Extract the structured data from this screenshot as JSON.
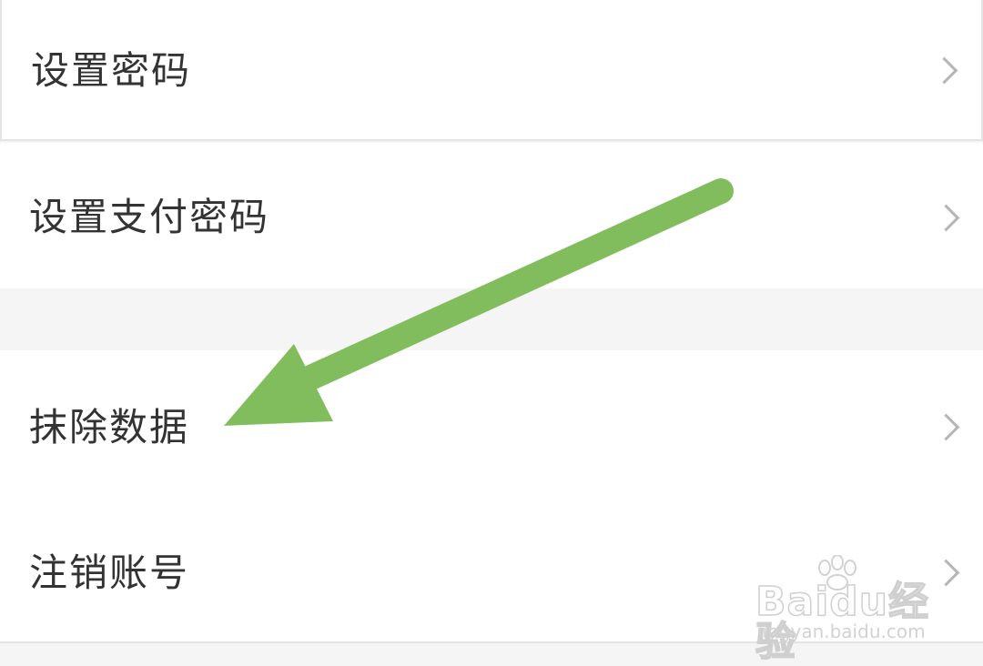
{
  "settings": {
    "items": [
      {
        "label": "设置密码"
      },
      {
        "label": "设置支付密码"
      },
      {
        "label": "抹除数据"
      },
      {
        "label": "注销账号"
      }
    ]
  },
  "annotation": {
    "arrow_color": "#82bd5d",
    "arrow_target": "抹除数据"
  },
  "watermark": {
    "brand": "Baidu经验",
    "url": "jingyan.baidu.com"
  },
  "colors": {
    "background": "#f5f5f5",
    "row": "#ffffff",
    "text": "#333333",
    "chevron": "#b5b5b5"
  }
}
